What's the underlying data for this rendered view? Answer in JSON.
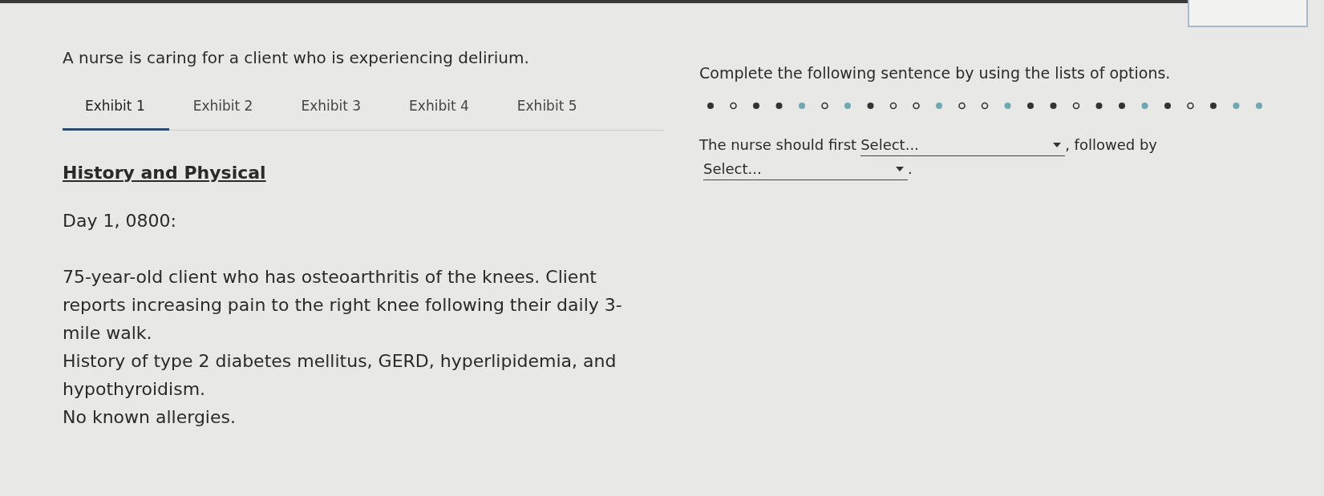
{
  "question": "A nurse is caring for a client who is experiencing delirium.",
  "tabs": [
    {
      "label": "Exhibit 1",
      "selected": true
    },
    {
      "label": "Exhibit 2",
      "selected": false
    },
    {
      "label": "Exhibit 3",
      "selected": false
    },
    {
      "label": "Exhibit 4",
      "selected": false
    },
    {
      "label": "Exhibit 5",
      "selected": false
    }
  ],
  "exhibit": {
    "heading": "History and Physical",
    "date_line": "Day 1, 0800:",
    "paragraphs": [
      "75-year-old client who has osteoarthritis of the knees. Client reports increasing pain to the right knee following their daily 3-mile walk.",
      "History of type 2 diabetes mellitus, GERD, hyperlipidemia, and hypothyroidism.",
      "No known allergies."
    ]
  },
  "instruction": "Complete the following sentence by using the lists of options.",
  "sentence": [
    {
      "kind": "text",
      "text": "The nurse should first"
    },
    {
      "kind": "dropdown",
      "placeholder": "Select..."
    },
    {
      "kind": "text",
      "text": ", followed by"
    },
    {
      "kind": "dropdown",
      "placeholder": "Select..."
    },
    {
      "kind": "text",
      "text": "."
    }
  ]
}
